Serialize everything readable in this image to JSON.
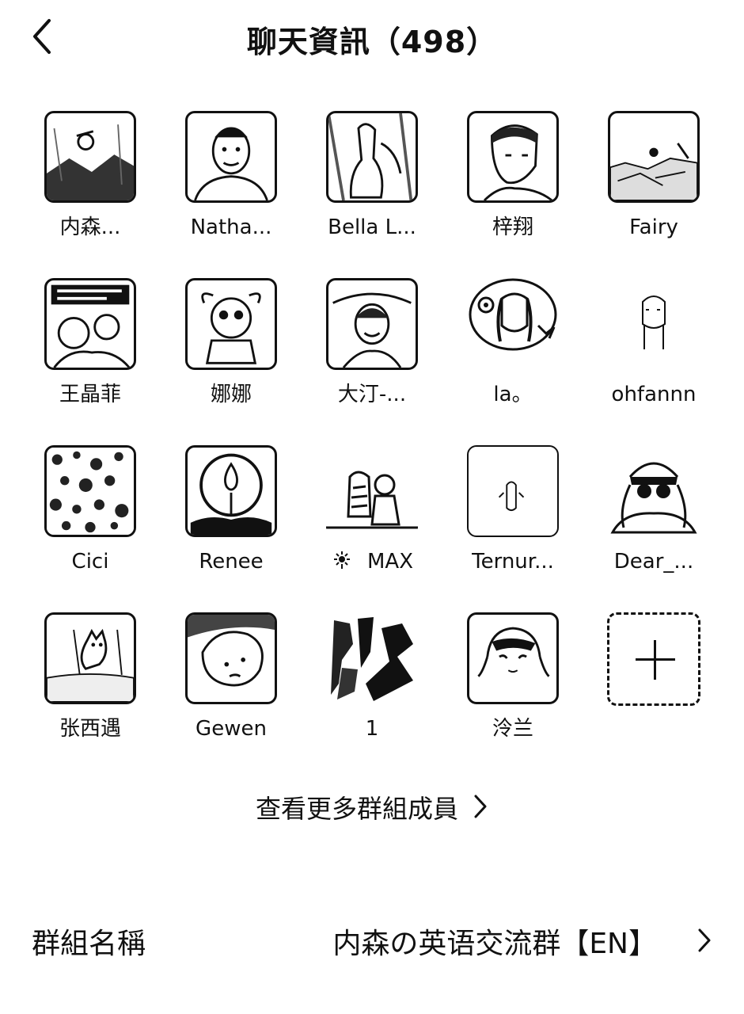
{
  "header": {
    "title": "聊天資訊（498）",
    "back_icon": "chevron-left-icon"
  },
  "members": [
    {
      "name": "内森...",
      "avatar": "sketch-scene"
    },
    {
      "name": "Natha...",
      "avatar": "man-portrait"
    },
    {
      "name": "Bella L...",
      "avatar": "woman-sitting"
    },
    {
      "name": "梓翔",
      "avatar": "man-profile"
    },
    {
      "name": "Fairy",
      "avatar": "winter-scene"
    },
    {
      "name": "王晶菲",
      "avatar": "comic-meme"
    },
    {
      "name": "娜娜",
      "avatar": "cartoon-character"
    },
    {
      "name": "大汀-...",
      "avatar": "smiling-woman"
    },
    {
      "name": "la。",
      "avatar": "girl-sticker"
    },
    {
      "name": "ohfannn",
      "avatar": "doodle-figure"
    },
    {
      "name": "Cici",
      "avatar": "texture-pattern"
    },
    {
      "name": "Renee",
      "avatar": "candle-flame"
    },
    {
      "name": "MAX",
      "avatar": "tiger-and-child",
      "prefix_icon": "flower-icon"
    },
    {
      "name": "Ternur...",
      "avatar": "small-figure"
    },
    {
      "name": "Dear_...",
      "avatar": "girl-with-glasses"
    },
    {
      "name": "张西遇",
      "avatar": "cat-cartoon"
    },
    {
      "name": "Gewen",
      "avatar": "duck-face"
    },
    {
      "name": "1",
      "avatar": "abstract-sketch"
    },
    {
      "name": "泠兰",
      "avatar": "anime-girl"
    }
  ],
  "add_member": {
    "icon": "plus-icon"
  },
  "see_more": {
    "label": "查看更多群組成員",
    "icon": "chevron-right-icon"
  },
  "group_name": {
    "label": "群組名稱",
    "value": "内森の英语交流群【EN】",
    "icon": "chevron-right-icon"
  }
}
